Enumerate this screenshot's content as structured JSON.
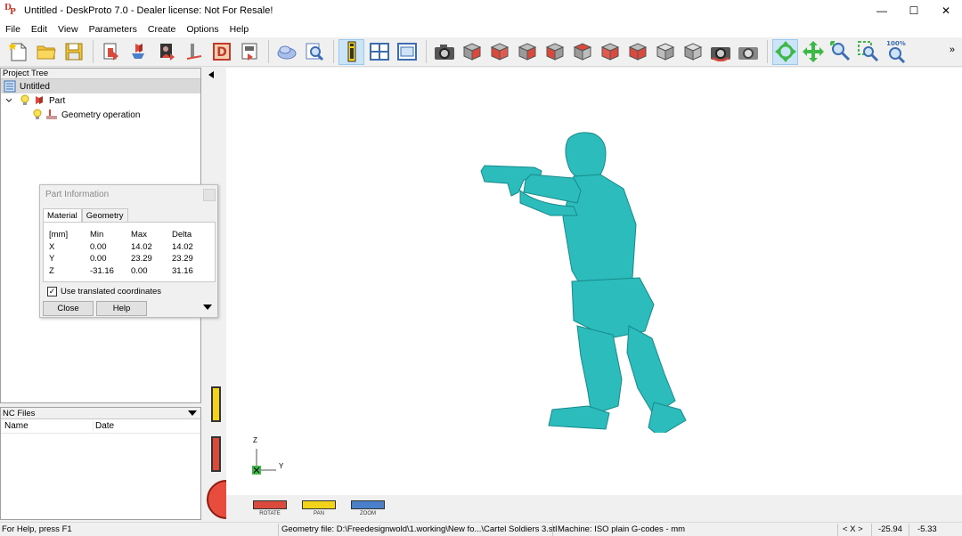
{
  "window": {
    "title": "Untitled - DeskProto 7.0 - Dealer license: Not For Resale!",
    "minimize": "—",
    "maximize": "☐",
    "close": "✕"
  },
  "menu": [
    "File",
    "Edit",
    "View",
    "Parameters",
    "Create",
    "Options",
    "Help"
  ],
  "toolbar": {
    "zoom_badge": "100%",
    "more": "»",
    "colors": {
      "red": "#d94a3d",
      "gray": "#9a9a9a",
      "green": "#3fb84a",
      "blue": "#4a7fc9",
      "yellow": "#f2d21b"
    }
  },
  "project_tree": {
    "header": "Project Tree",
    "root": "Untitled",
    "part": "Part",
    "operation": "Geometry operation"
  },
  "nc_files": {
    "header": "NC Files",
    "col_name": "Name",
    "col_date": "Date"
  },
  "part_info": {
    "title": "Part Information",
    "tabs": [
      "Material",
      "Geometry"
    ],
    "table": {
      "headers": [
        "[mm]",
        "Min",
        "Max",
        "Delta"
      ],
      "rows": [
        [
          "X",
          "0.00",
          "14.02",
          "14.02"
        ],
        [
          "Y",
          "0.00",
          "23.29",
          "23.29"
        ],
        [
          "Z",
          "-31.16",
          "0.00",
          "31.16"
        ]
      ]
    },
    "checkbox_label": "Use translated coordinates",
    "checkbox_checked": true,
    "close_label": "Close",
    "help_label": "Help"
  },
  "viewport": {
    "axis_z": "Z",
    "axis_y": "Y",
    "model_color": "#2cbcbc",
    "controls": [
      "ROTATE",
      "PAN",
      "ZOOM"
    ]
  },
  "status": {
    "help": "For Help, press F1",
    "geometry_file": "Geometry file: D:\\Freedesignwold\\1.working\\New fo...\\Cartel Soldiers 3.stl",
    "machine": "Machine: ISO plain G-codes - mm",
    "axis": "< X >",
    "coord_x": "-25.94",
    "coord_y": "-5.33"
  }
}
